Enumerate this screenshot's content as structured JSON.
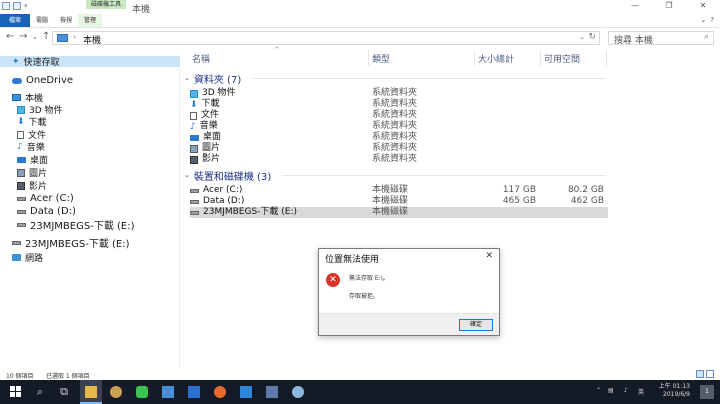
{
  "window": {
    "title": "本機",
    "contextual_tab_group": "磁碟機工具",
    "controls": [
      "—",
      "❐",
      "✕"
    ]
  },
  "ribbon": {
    "tabs": [
      "檔案",
      "電腦",
      "檢視",
      "管理"
    ]
  },
  "address": {
    "crumb": "本機",
    "search_placeholder": "搜尋 本機"
  },
  "nav": {
    "quick_access": "快速存取",
    "onedrive": "OneDrive",
    "this_pc": "本機",
    "pc_children": [
      {
        "label": "3D 物件",
        "icon": "cube-icon"
      },
      {
        "label": "下載",
        "icon": "download-arrow-icon"
      },
      {
        "label": "文件",
        "icon": "document-icon"
      },
      {
        "label": "音樂",
        "icon": "music-note-icon"
      },
      {
        "label": "桌面",
        "icon": "desktop-icon"
      },
      {
        "label": "圖片",
        "icon": "picture-icon"
      },
      {
        "label": "影片",
        "icon": "video-icon"
      },
      {
        "label": "Acer (C:)",
        "icon": "drive-icon"
      },
      {
        "label": "Data (D:)",
        "icon": "drive-icon"
      },
      {
        "label": "23MJMBEGS-下載 (E:)",
        "icon": "drive-icon"
      }
    ],
    "removable": "23MJMBEGS-下載 (E:)",
    "network": "網路"
  },
  "columns": {
    "name": "名稱",
    "type": "類型",
    "total": "大小總計",
    "free": "可用空間"
  },
  "groups": {
    "folders": "資料夾 (7)",
    "drives": "裝置和磁碟機 (3)"
  },
  "folders": [
    {
      "name": "3D 物件",
      "type": "系統資料夾"
    },
    {
      "name": "下載",
      "type": "系統資料夾"
    },
    {
      "name": "文件",
      "type": "系統資料夾"
    },
    {
      "name": "音樂",
      "type": "系統資料夾"
    },
    {
      "name": "桌面",
      "type": "系統資料夾"
    },
    {
      "name": "圖片",
      "type": "系統資料夾"
    },
    {
      "name": "影片",
      "type": "系統資料夾"
    }
  ],
  "drives": [
    {
      "name": "Acer (C:)",
      "type": "本機磁碟",
      "total": "117 GB",
      "free": "80.2 GB"
    },
    {
      "name": "Data (D:)",
      "type": "本機磁碟",
      "total": "465 GB",
      "free": "462 GB"
    },
    {
      "name": "23MJMBEGS-下載 (E:)",
      "type": "本機磁碟",
      "total": "",
      "free": ""
    }
  ],
  "status": {
    "items": "10 個項目",
    "selected": "已選取 1 個項目"
  },
  "dialog": {
    "title": "位置無法使用",
    "message1": "無法存取 E:\\。",
    "message2": "存取被拒。",
    "ok": "確定"
  },
  "taskbar": {
    "ime": "英",
    "clock_time": "上午 01:13",
    "clock_date": "2019/6/9",
    "notification_count": "1"
  },
  "colors": {
    "accent": "#1a64b8",
    "selection": "#cce4f7",
    "error": "#d9342b",
    "taskbar": "#141a26"
  }
}
